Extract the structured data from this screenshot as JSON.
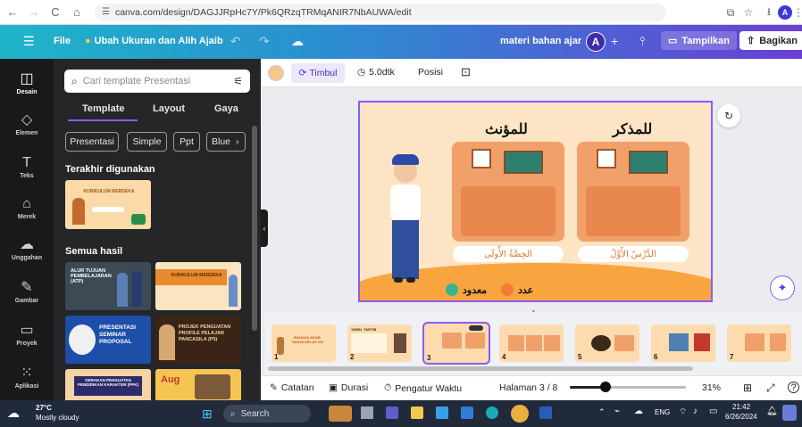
{
  "browser": {
    "url": "canva.com/design/DAGJJRpHc7Y/Pk6QRzqTRMqANIR7NbAUWA/edit",
    "profile_initial": "A"
  },
  "toolbar": {
    "menu_icon": "hamburger-icon",
    "file_label": "File",
    "resize_label": "Ubah Ukuran dan Alih Ajaib",
    "design_name": "materi bahan ajar",
    "avatar_initial": "A",
    "present_label": "Tampilkan",
    "share_label": "Bagikan"
  },
  "rail": [
    {
      "label": "Desain",
      "icon": "layout-icon"
    },
    {
      "label": "Elemen",
      "icon": "shapes-icon"
    },
    {
      "label": "Teks",
      "icon": "text-icon"
    },
    {
      "label": "Merek",
      "icon": "brand-icon"
    },
    {
      "label": "Unggahan",
      "icon": "upload-icon"
    },
    {
      "label": "Gambar",
      "icon": "draw-icon"
    },
    {
      "label": "Proyek",
      "icon": "folder-icon"
    },
    {
      "label": "Aplikasi",
      "icon": "apps-icon"
    }
  ],
  "panel": {
    "search_placeholder": "Cari template Presentasi",
    "tabs": [
      "Template",
      "Layout",
      "Gaya"
    ],
    "chips": [
      "Presentasi",
      "Simple",
      "Ppt",
      "Blue"
    ],
    "recent_title": "Terakhir digunakan",
    "all_results_title": "Semua hasil",
    "recent_thumb_title": "KURIKULUM MERDEKA",
    "results": [
      {
        "title": "ALUR TUJUAN PEMBELAJARAN (ATP)"
      },
      {
        "title": "KURIKULUM MERDEKA"
      },
      {
        "title": "PRESENTASI SEMINAR PROPOSAL"
      },
      {
        "title": "PROJEK PENGUATAN PROFILE PELAJAR PANCASILA (P5)"
      },
      {
        "title": "GERAKAN PENGUATAN PENDIDIKAN KARAKTER (PPK)"
      },
      {
        "title": "Aug"
      }
    ]
  },
  "context": {
    "color_swatch": "#f7c58f",
    "animate_label": "Timbul",
    "duration_label": "5.0dtk",
    "position_label": "Posisi"
  },
  "slide": {
    "heading_left": "للمؤنث",
    "heading_right": "للمذكر",
    "caption_left": "الحِصَّةُ الأُولَى",
    "caption_right": "الدَّرْسُ الأَوَّلُ",
    "legend_count": "معدود",
    "legend_number": "عدد",
    "legend_count_color": "#3bb38f",
    "legend_number_color": "#f07d3a"
  },
  "filmstrip": {
    "pages": [
      "1",
      "2",
      "3",
      "4",
      "5",
      "6",
      "7"
    ],
    "active_page": "3",
    "thumb1_title": "BAHASA ARAB TAHUN KELAS VIII",
    "thumb2_title": "TABEL TARTIB"
  },
  "bottombar": {
    "notes_label": "Catatan",
    "duration_label": "Durasi",
    "timer_label": "Pengatur Waktu",
    "page_label": "Halaman 3 / 8",
    "zoom_label": "31%",
    "zoom_fraction": 0.31
  },
  "taskbar": {
    "temp": "27°C",
    "weather": "Mostly cloudy",
    "search_label": "Search",
    "lang": "ENG",
    "time": "21:42",
    "date": "6/26/2024"
  }
}
